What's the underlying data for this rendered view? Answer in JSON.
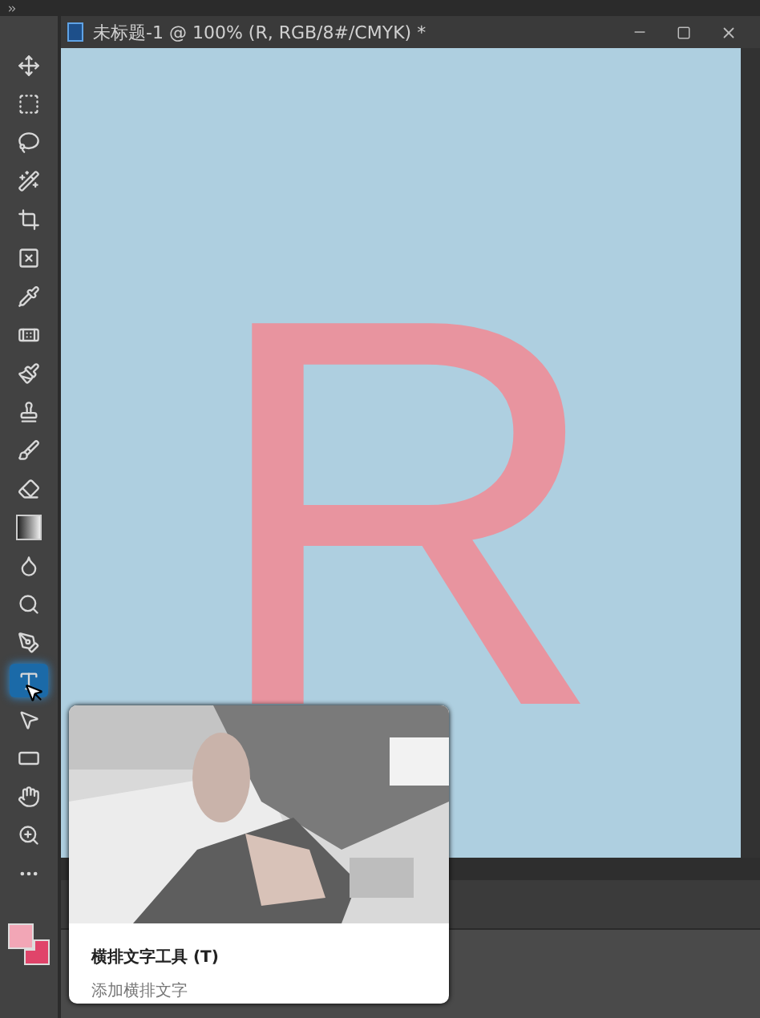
{
  "document": {
    "title": "未标题-1 @ 100% (R, RGB/8#/CMYK) *",
    "canvas_text": "R"
  },
  "tools": [
    {
      "kind": "move",
      "selected": false
    },
    {
      "kind": "marquee",
      "selected": false
    },
    {
      "kind": "lasso",
      "selected": false
    },
    {
      "kind": "wand",
      "selected": false
    },
    {
      "kind": "crop",
      "selected": false
    },
    {
      "kind": "frame",
      "selected": false
    },
    {
      "kind": "eyedropper",
      "selected": false
    },
    {
      "kind": "healing",
      "selected": false
    },
    {
      "kind": "brush",
      "selected": false
    },
    {
      "kind": "stamp",
      "selected": false
    },
    {
      "kind": "history",
      "selected": false
    },
    {
      "kind": "eraser",
      "selected": false
    },
    {
      "kind": "gradient",
      "selected": false
    },
    {
      "kind": "smudge",
      "selected": false
    },
    {
      "kind": "dodge",
      "selected": false
    },
    {
      "kind": "pen",
      "selected": false
    },
    {
      "kind": "type",
      "selected": true
    },
    {
      "kind": "select",
      "selected": false
    },
    {
      "kind": "shape",
      "selected": false
    },
    {
      "kind": "hand",
      "selected": false
    },
    {
      "kind": "zoom",
      "selected": false
    },
    {
      "kind": "more",
      "selected": false
    }
  ],
  "color_swatches": [
    {
      "kind": "foreground",
      "color": "#f2a6b6"
    },
    {
      "kind": "background",
      "color": "#e0446a"
    }
  ],
  "tooltip": {
    "title": "横排文字工具 (T)",
    "description": "添加横排文字"
  }
}
